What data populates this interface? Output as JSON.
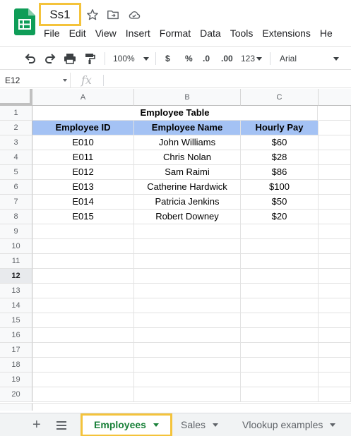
{
  "title_bar": {
    "doc_title": "Ss1",
    "icons": [
      "star-icon",
      "move-to-folder-icon",
      "cloud-status-icon"
    ]
  },
  "menu": [
    "File",
    "Edit",
    "View",
    "Insert",
    "Format",
    "Data",
    "Tools",
    "Extensions",
    "He"
  ],
  "toolbar": {
    "zoom": "100%",
    "currency": "$",
    "percent": "%",
    "decrease_decimal": ".0",
    "increase_decimal": ".00",
    "number_format": "123",
    "font": "Arial"
  },
  "formula_bar": {
    "cell_ref": "E12",
    "fx": "fx",
    "value": ""
  },
  "grid": {
    "columns": [
      "A",
      "B",
      "C"
    ],
    "rows": [
      "1",
      "2",
      "3",
      "4",
      "5",
      "6",
      "7",
      "8",
      "9",
      "10",
      "11",
      "12",
      "13",
      "14",
      "15",
      "16",
      "17",
      "18",
      "19",
      "20"
    ],
    "active_row": "12",
    "table_title": "Employee Table",
    "headers": [
      "Employee ID",
      "Employee Name",
      "Hourly Pay"
    ],
    "header_color": "#a4c2f4",
    "data": [
      [
        "E010",
        "John Williams",
        "$60"
      ],
      [
        "E011",
        "Chris Nolan",
        "$28"
      ],
      [
        "E012",
        "Sam Raimi",
        "$86"
      ],
      [
        "E013",
        "Catherine Hardwick",
        "$100"
      ],
      [
        "E014",
        "Patricia Jenkins",
        "$50"
      ],
      [
        "E015",
        "Robert Downey",
        "$20"
      ]
    ]
  },
  "sheets": {
    "active": "Employees",
    "tabs": [
      "Employees",
      "Sales",
      "Vlookup examples"
    ]
  },
  "colors": {
    "highlight": "#f4c33b",
    "active_tab_text": "#188038",
    "sheets_green": "#0f9d58"
  }
}
